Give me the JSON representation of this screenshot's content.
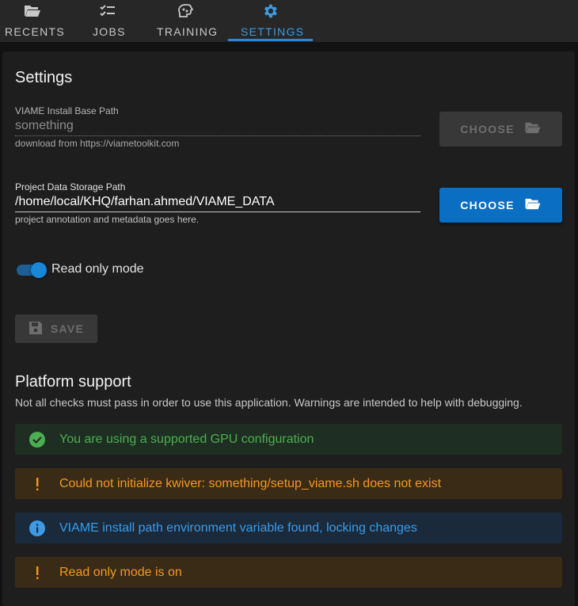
{
  "nav": {
    "tabs": [
      {
        "label": "RECENTS",
        "icon": "folder-open-icon"
      },
      {
        "label": "JOBS",
        "icon": "checklist-icon"
      },
      {
        "label": "TRAINING",
        "icon": "brain-icon"
      },
      {
        "label": "SETTINGS",
        "icon": "gear-icon",
        "active": true
      }
    ]
  },
  "settings": {
    "title": "Settings",
    "install_path": {
      "label": "VIAME Install Base Path",
      "value": "something",
      "hint": "download from https://viametoolkit.com",
      "button": "CHOOSE",
      "disabled": true
    },
    "data_path": {
      "label": "Project Data Storage Path",
      "value": "/home/local/KHQ/farhan.ahmed/VIAME_DATA",
      "hint": "project annotation and metadata goes here.",
      "button": "CHOOSE"
    },
    "read_only": {
      "label": "Read only mode",
      "on": true
    },
    "save_label": "SAVE"
  },
  "platform": {
    "title": "Platform support",
    "subtitle": "Not all checks must pass in order to use this application. Warnings are intended to help with debugging.",
    "alerts": [
      {
        "type": "success",
        "icon": "check-circle-icon",
        "text": "You are using a supported GPU configuration"
      },
      {
        "type": "warning",
        "icon": "exclamation-icon",
        "text": "Could not initialize kwiver: something/setup_viame.sh does not exist"
      },
      {
        "type": "info",
        "icon": "info-circle-icon",
        "text": "VIAME install path environment variable found, locking changes"
      },
      {
        "type": "warning",
        "icon": "exclamation-icon",
        "text": "Read only mode is on"
      }
    ]
  },
  "colors": {
    "accent": "#0a6fc2",
    "success": "#4cae50",
    "warning": "#f39820",
    "info": "#3b9be8"
  }
}
